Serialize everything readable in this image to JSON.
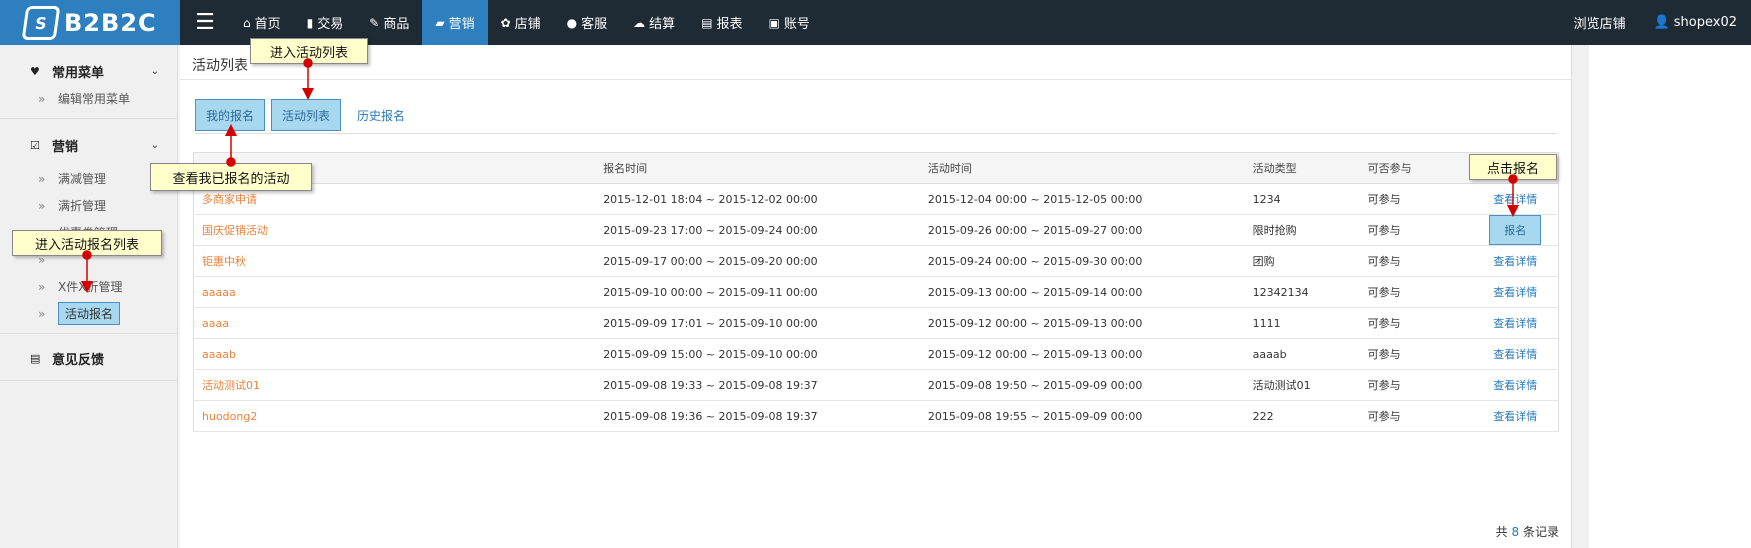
{
  "logo": {
    "mark": "S",
    "brand": "B2B2C"
  },
  "nav": [
    {
      "icon": "home-icon",
      "glyph": "⌂",
      "label": "首页"
    },
    {
      "icon": "bar-chart-icon",
      "glyph": "▮",
      "label": "交易"
    },
    {
      "icon": "edit-icon",
      "glyph": "✎",
      "label": "商品"
    },
    {
      "icon": "bookmark-icon",
      "glyph": "▰",
      "label": "营销",
      "active": true
    },
    {
      "icon": "gear-icon",
      "glyph": "✿",
      "label": "店铺"
    },
    {
      "icon": "chat-icon",
      "glyph": "●",
      "label": "客服"
    },
    {
      "icon": "cloud-icon",
      "glyph": "☁",
      "label": "结算"
    },
    {
      "icon": "report-icon",
      "glyph": "▤",
      "label": "报表"
    },
    {
      "icon": "lock-icon",
      "glyph": "▣",
      "label": "账号"
    }
  ],
  "top_right": {
    "browse": "浏览店铺",
    "user": "shopex02"
  },
  "sidebar": {
    "common": {
      "title": "常用菜单",
      "items": [
        "编辑常用菜单"
      ]
    },
    "marketing": {
      "title": "营销",
      "items": [
        "满减管理",
        "满折管理",
        "优惠券管理",
        "",
        "X件X折管理",
        "活动报名"
      ]
    },
    "feedback": {
      "title": "意见反馈"
    }
  },
  "main": {
    "title": "活动列表",
    "tabs": [
      "我的报名",
      "活动列表",
      "历史报名"
    ],
    "headers": [
      "",
      "报名时间",
      "活动时间",
      "活动类型",
      "可否参与",
      ""
    ],
    "rows": [
      {
        "name": "多商家申请",
        "signup": "2015-12-01 18:04 ~ 2015-12-02 00:00",
        "period": "2015-12-04 00:00 ~ 2015-12-05 00:00",
        "type": "1234",
        "can": "可参与",
        "action": "查看详情"
      },
      {
        "name": "国庆促销活动",
        "signup": "2015-09-23 17:00 ~ 2015-09-24 00:00",
        "period": "2015-09-26 00:00 ~ 2015-09-27 00:00",
        "type": "限时抢购",
        "can": "可参与",
        "action": "报名"
      },
      {
        "name": "钜惠中秋",
        "signup": "2015-09-17 00:00 ~ 2015-09-20 00:00",
        "period": "2015-09-24 00:00 ~ 2015-09-30 00:00",
        "type": "团购",
        "can": "可参与",
        "action": "查看详情"
      },
      {
        "name": "aaaaa",
        "signup": "2015-09-10 00:00 ~ 2015-09-11 00:00",
        "period": "2015-09-13 00:00 ~ 2015-09-14 00:00",
        "type": "12342134",
        "can": "可参与",
        "action": "查看详情"
      },
      {
        "name": "aaaa",
        "signup": "2015-09-09 17:01 ~ 2015-09-10 00:00",
        "period": "2015-09-12 00:00 ~ 2015-09-13 00:00",
        "type": "1111",
        "can": "可参与",
        "action": "查看详情"
      },
      {
        "name": "aaaab",
        "signup": "2015-09-09 15:00 ~ 2015-09-10 00:00",
        "period": "2015-09-12 00:00 ~ 2015-09-13 00:00",
        "type": "aaaab",
        "can": "可参与",
        "action": "查看详情"
      },
      {
        "name": "活动测试01",
        "signup": "2015-09-08 19:33 ~ 2015-09-08 19:37",
        "period": "2015-09-08 19:50 ~ 2015-09-09 00:00",
        "type": "活动测试01",
        "can": "可参与",
        "action": "查看详情"
      },
      {
        "name": "huodong2",
        "signup": "2015-09-08 19:36 ~ 2015-09-08 19:37",
        "period": "2015-09-08 19:55 ~ 2015-09-09 00:00",
        "type": "222",
        "can": "可参与",
        "action": "查看详情"
      }
    ],
    "footer": {
      "prefix": "共",
      "count": "8",
      "suffix": "条记录"
    }
  },
  "callouts": {
    "enter_list": "进入活动列表",
    "view_mine": "查看我已报名的活动",
    "enter_signup_list": "进入活动报名列表",
    "click_signup": "点击报名"
  }
}
